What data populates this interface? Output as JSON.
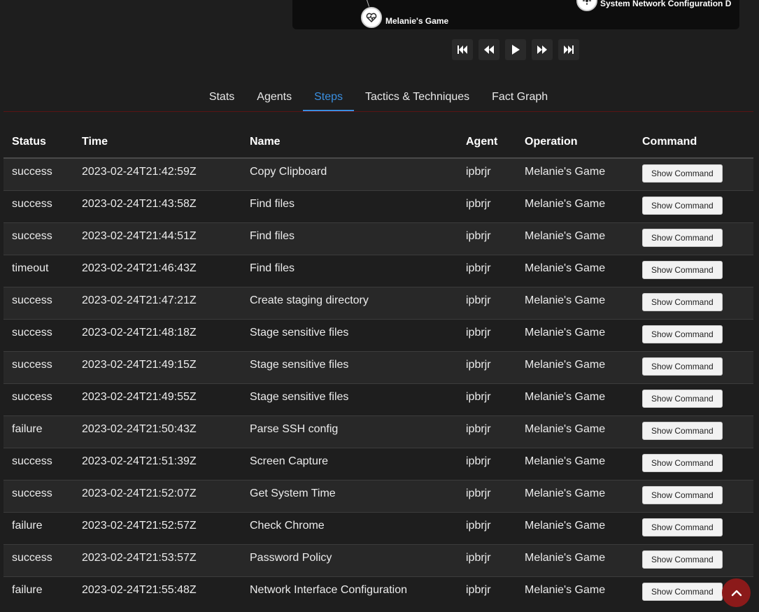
{
  "graph": {
    "nodes": [
      {
        "label": "Melanie's Game",
        "icon": "heartbeat-icon"
      },
      {
        "label": "System Network Configuration D",
        "icon": "network-icon"
      }
    ]
  },
  "playback": {
    "buttons": [
      "skip-start-icon",
      "step-back-icon",
      "play-icon",
      "step-forward-icon",
      "skip-end-icon"
    ]
  },
  "tabs": [
    {
      "label": "Stats",
      "active": false
    },
    {
      "label": "Agents",
      "active": false
    },
    {
      "label": "Steps",
      "active": true
    },
    {
      "label": "Tactics & Techniques",
      "active": false
    },
    {
      "label": "Fact Graph",
      "active": false
    }
  ],
  "table": {
    "columns": [
      "Status",
      "Time",
      "Name",
      "Agent",
      "Operation",
      "Command"
    ],
    "rows": [
      {
        "status": "success",
        "time": "2023-02-24T21:42:59Z",
        "name": "Copy Clipboard",
        "agent": "ipbrjr",
        "operation": "Melanie's Game",
        "command": "Show Command"
      },
      {
        "status": "success",
        "time": "2023-02-24T21:43:58Z",
        "name": "Find files",
        "agent": "ipbrjr",
        "operation": "Melanie's Game",
        "command": "Show Command"
      },
      {
        "status": "success",
        "time": "2023-02-24T21:44:51Z",
        "name": "Find files",
        "agent": "ipbrjr",
        "operation": "Melanie's Game",
        "command": "Show Command"
      },
      {
        "status": "timeout",
        "time": "2023-02-24T21:46:43Z",
        "name": "Find files",
        "agent": "ipbrjr",
        "operation": "Melanie's Game",
        "command": "Show Command"
      },
      {
        "status": "success",
        "time": "2023-02-24T21:47:21Z",
        "name": "Create staging directory",
        "agent": "ipbrjr",
        "operation": "Melanie's Game",
        "command": "Show Command"
      },
      {
        "status": "success",
        "time": "2023-02-24T21:48:18Z",
        "name": "Stage sensitive files",
        "agent": "ipbrjr",
        "operation": "Melanie's Game",
        "command": "Show Command"
      },
      {
        "status": "success",
        "time": "2023-02-24T21:49:15Z",
        "name": "Stage sensitive files",
        "agent": "ipbrjr",
        "operation": "Melanie's Game",
        "command": "Show Command"
      },
      {
        "status": "success",
        "time": "2023-02-24T21:49:55Z",
        "name": "Stage sensitive files",
        "agent": "ipbrjr",
        "operation": "Melanie's Game",
        "command": "Show Command"
      },
      {
        "status": "failure",
        "time": "2023-02-24T21:50:43Z",
        "name": "Parse SSH config",
        "agent": "ipbrjr",
        "operation": "Melanie's Game",
        "command": "Show Command"
      },
      {
        "status": "success",
        "time": "2023-02-24T21:51:39Z",
        "name": "Screen Capture",
        "agent": "ipbrjr",
        "operation": "Melanie's Game",
        "command": "Show Command"
      },
      {
        "status": "success",
        "time": "2023-02-24T21:52:07Z",
        "name": "Get System Time",
        "agent": "ipbrjr",
        "operation": "Melanie's Game",
        "command": "Show Command"
      },
      {
        "status": "failure",
        "time": "2023-02-24T21:52:57Z",
        "name": "Check Chrome",
        "agent": "ipbrjr",
        "operation": "Melanie's Game",
        "command": "Show Command"
      },
      {
        "status": "success",
        "time": "2023-02-24T21:53:57Z",
        "name": "Password Policy",
        "agent": "ipbrjr",
        "operation": "Melanie's Game",
        "command": "Show Command"
      },
      {
        "status": "failure",
        "time": "2023-02-24T21:55:48Z",
        "name": "Network Interface Configuration",
        "agent": "ipbrjr",
        "operation": "Melanie's Game",
        "command": "Show Command"
      }
    ]
  },
  "scroll_top": {
    "icon": "chevron-up-icon"
  },
  "colors": {
    "accent": "#3a8fe0",
    "brand": "#8b1a1a"
  }
}
